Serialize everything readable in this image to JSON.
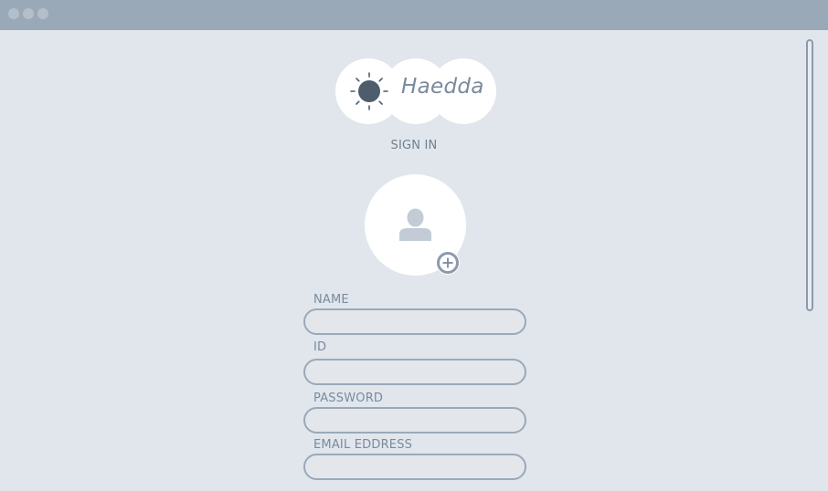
{
  "window": {
    "traffic_lights": [
      "close",
      "minimize",
      "maximize"
    ]
  },
  "logo": {
    "text": "Haedda",
    "icon": "sun-icon"
  },
  "heading": "SIGN IN",
  "avatar": {
    "icon": "person-icon",
    "add_icon": "plus-circle-icon"
  },
  "form": {
    "name_label": "NAME",
    "name_value": "",
    "id_label": "ID",
    "id_value": "",
    "password_label": "PASSWORD",
    "password_value": "",
    "email_label": "EMAIL EDDRESS",
    "email_value": ""
  },
  "colors": {
    "background": "#e1e6ed",
    "titlebar": "#9aa9b8",
    "accent": "#4e5d6c",
    "text": "#7a8a9c"
  }
}
